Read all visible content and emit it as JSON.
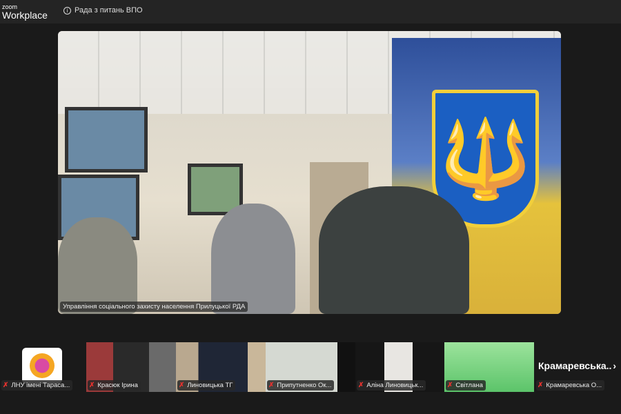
{
  "app": {
    "brand_small": "zoom",
    "brand_large": "Workplace",
    "meeting_title": "Рада з питань ВПО"
  },
  "main_video": {
    "participant": "Управління соціального захисту населення Прилуцької РДА"
  },
  "thumbnails": [
    {
      "name": "ЛНУ імені Тараса..."
    },
    {
      "name": "Красюк Ірина"
    },
    {
      "name": "Линовицька ТГ"
    },
    {
      "name": "Припутненко Ок..."
    },
    {
      "name": "Аліна Линовицьк..."
    },
    {
      "name": "Світлана"
    },
    {
      "name": "Крамаревська О..."
    }
  ],
  "next_tile": {
    "display_name": "Крамаревська.."
  },
  "icons": {
    "info": "info-icon",
    "mic": "mic-muted-icon",
    "next": "chevron-right-icon"
  }
}
